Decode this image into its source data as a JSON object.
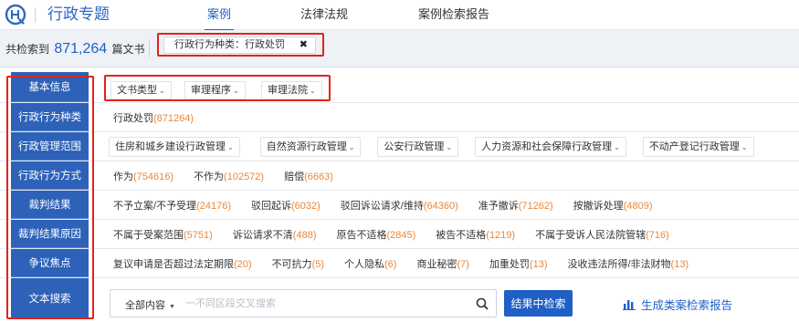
{
  "header": {
    "brand_title": "行政专题",
    "tabs": [
      {
        "label": "案例",
        "active": true
      },
      {
        "label": "法律法规",
        "active": false
      },
      {
        "label": "案例检索报告",
        "active": false
      }
    ]
  },
  "summary": {
    "prefix": "共检索到",
    "count": "871,264",
    "suffix": "篇文书",
    "active_filter": "行政行为种类：行政处罚",
    "close_glyph": "✖"
  },
  "filters": {
    "basic": {
      "label": "基本信息",
      "dropdowns": [
        "文书类型",
        "审理程序",
        "审理法院"
      ]
    },
    "category": {
      "label": "行政行为种类",
      "items": [
        {
          "name": "行政处罚",
          "count": "(871264)"
        }
      ]
    },
    "scope": {
      "label": "行政管理范围",
      "dropdowns": [
        "住房和城乡建设行政管理",
        "自然资源行政管理",
        "公安行政管理",
        "人力资源和社会保障行政管理",
        "不动产登记行政管理"
      ]
    },
    "method": {
      "label": "行政行为方式",
      "items": [
        {
          "name": "作为",
          "count": "(754616)"
        },
        {
          "name": "不作为",
          "count": "(102572)"
        },
        {
          "name": "赔偿",
          "count": "(6663)"
        }
      ]
    },
    "result": {
      "label": "裁判结果",
      "items": [
        {
          "name": "不予立案/不予受理",
          "count": "(24176)"
        },
        {
          "name": "驳回起诉",
          "count": "(6032)"
        },
        {
          "name": "驳回诉讼请求/维持",
          "count": "(64360)"
        },
        {
          "name": "准予撤诉",
          "count": "(71262)"
        },
        {
          "name": "按撤诉处理",
          "count": "(4809)"
        }
      ]
    },
    "reason": {
      "label": "裁判结果原因",
      "items": [
        {
          "name": "不属于受案范围",
          "count": "(5751)"
        },
        {
          "name": "诉讼请求不清",
          "count": "(488)"
        },
        {
          "name": "原告不适格",
          "count": "(2845)"
        },
        {
          "name": "被告不适格",
          "count": "(1219)"
        },
        {
          "name": "不属于受诉人民法院管辖",
          "count": "(716)"
        }
      ]
    },
    "dispute": {
      "label": "争议焦点",
      "items": [
        {
          "name": "复议申请是否超过法定期限",
          "count": "(20)"
        },
        {
          "name": "不可抗力",
          "count": "(5)"
        },
        {
          "name": "个人隐私",
          "count": "(6)"
        },
        {
          "name": "商业秘密",
          "count": "(7)"
        },
        {
          "name": "加重处罚",
          "count": "(13)"
        },
        {
          "name": "没收违法所得/非法财物",
          "count": "(13)"
        }
      ]
    },
    "text_search": {
      "label": "文本搜索",
      "scope": "全部内容",
      "placeholder": "一不同区段交叉搜索",
      "button": "结果中检索",
      "report_link": "生成类案检索报告"
    }
  },
  "colors": {
    "accent": "#1f5fc6",
    "label_bg": "#2d62b8",
    "count": "#e9883a",
    "highlight_frame": "#e2231a"
  }
}
